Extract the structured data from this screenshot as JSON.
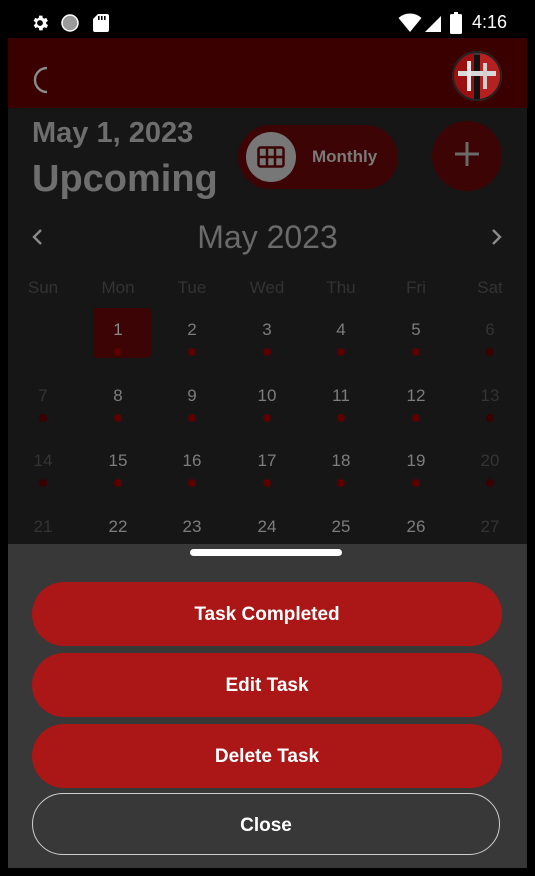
{
  "status_bar": {
    "time": "4:16",
    "icons": [
      "gear-icon",
      "circle-icon",
      "sd-card-icon",
      "wifi-icon",
      "signal-icon",
      "battery-icon"
    ]
  },
  "app_bar": {
    "theme_icon": "moon-icon",
    "avatar_icon": "avatar"
  },
  "header": {
    "date": "May 1, 2023",
    "section_title": "Upcoming",
    "view_toggle_label": "Monthly",
    "view_toggle_icon": "grid-icon",
    "add_icon": "plus-icon"
  },
  "calendar": {
    "month_title": "May 2023",
    "weekdays": [
      "Sun",
      "Mon",
      "Tue",
      "Wed",
      "Thu",
      "Fri",
      "Sat"
    ],
    "selected_day": "1",
    "rows": [
      [
        {
          "n": "",
          "dot": false,
          "muted": false
        },
        {
          "n": "1",
          "dot": true,
          "muted": false,
          "selected": true
        },
        {
          "n": "2",
          "dot": true,
          "muted": false
        },
        {
          "n": "3",
          "dot": true,
          "muted": false
        },
        {
          "n": "4",
          "dot": true,
          "muted": false
        },
        {
          "n": "5",
          "dot": true,
          "muted": false
        },
        {
          "n": "6",
          "dot": true,
          "muted": true
        }
      ],
      [
        {
          "n": "7",
          "dot": true,
          "muted": true
        },
        {
          "n": "8",
          "dot": true,
          "muted": false
        },
        {
          "n": "9",
          "dot": true,
          "muted": false
        },
        {
          "n": "10",
          "dot": true,
          "muted": false
        },
        {
          "n": "11",
          "dot": true,
          "muted": false
        },
        {
          "n": "12",
          "dot": true,
          "muted": false
        },
        {
          "n": "13",
          "dot": true,
          "muted": true
        }
      ],
      [
        {
          "n": "14",
          "dot": true,
          "muted": true
        },
        {
          "n": "15",
          "dot": true,
          "muted": false
        },
        {
          "n": "16",
          "dot": true,
          "muted": false
        },
        {
          "n": "17",
          "dot": true,
          "muted": false
        },
        {
          "n": "18",
          "dot": true,
          "muted": false
        },
        {
          "n": "19",
          "dot": true,
          "muted": false
        },
        {
          "n": "20",
          "dot": true,
          "muted": true
        }
      ],
      [
        {
          "n": "21",
          "dot": false,
          "muted": true
        },
        {
          "n": "22",
          "dot": false,
          "muted": false
        },
        {
          "n": "23",
          "dot": false,
          "muted": false
        },
        {
          "n": "24",
          "dot": false,
          "muted": false
        },
        {
          "n": "25",
          "dot": false,
          "muted": false
        },
        {
          "n": "26",
          "dot": false,
          "muted": false
        },
        {
          "n": "27",
          "dot": false,
          "muted": true
        }
      ]
    ]
  },
  "sheet": {
    "actions": [
      {
        "label": "Task Completed"
      },
      {
        "label": "Edit Task"
      },
      {
        "label": "Delete Task"
      }
    ],
    "close_label": "Close"
  },
  "colors": {
    "accent": "#ab1616",
    "app_bar": "#3a0000",
    "background": "#161616",
    "sheet": "#383838"
  }
}
